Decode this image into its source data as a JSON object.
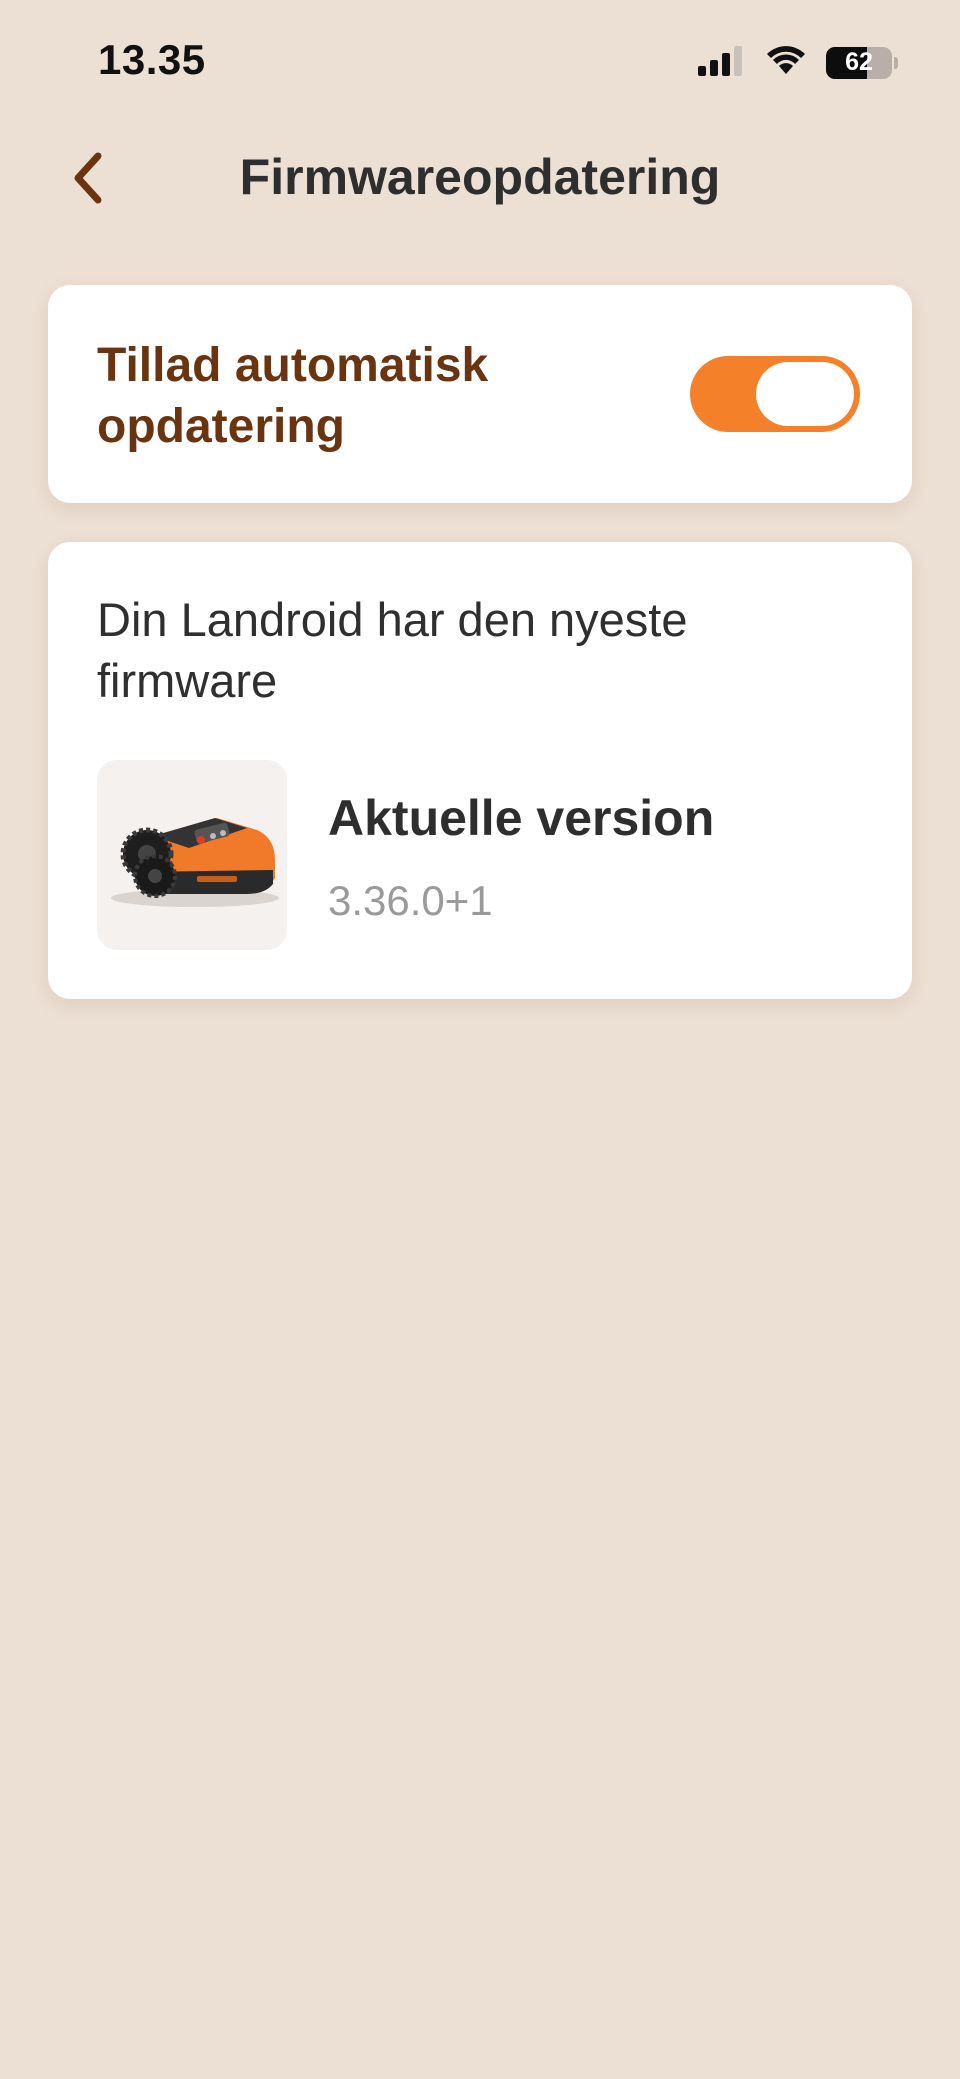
{
  "status_bar": {
    "time": "13.35",
    "battery_percent": "62",
    "battery_level": 0.62,
    "icons": [
      "cellular-signal-icon",
      "wifi-icon",
      "battery-icon"
    ]
  },
  "header": {
    "title": "Firmwareopdatering",
    "back_icon": "chevron-left-icon"
  },
  "auto_update": {
    "label": "Tillad automatisk opdatering",
    "enabled": true
  },
  "firmware": {
    "message": "Din Landroid har den nyeste firmware",
    "current_version_label": "Aktuelle version",
    "current_version_value": "3.36.0+1",
    "product_image": "robotic-lawn-mower-image"
  },
  "colors": {
    "background": "#ecdfd3",
    "card": "#ffffff",
    "accent": "#f4802a",
    "label_brown": "#6b3410",
    "title_text": "#2e2e2e",
    "muted_text": "#9a9a9a"
  }
}
